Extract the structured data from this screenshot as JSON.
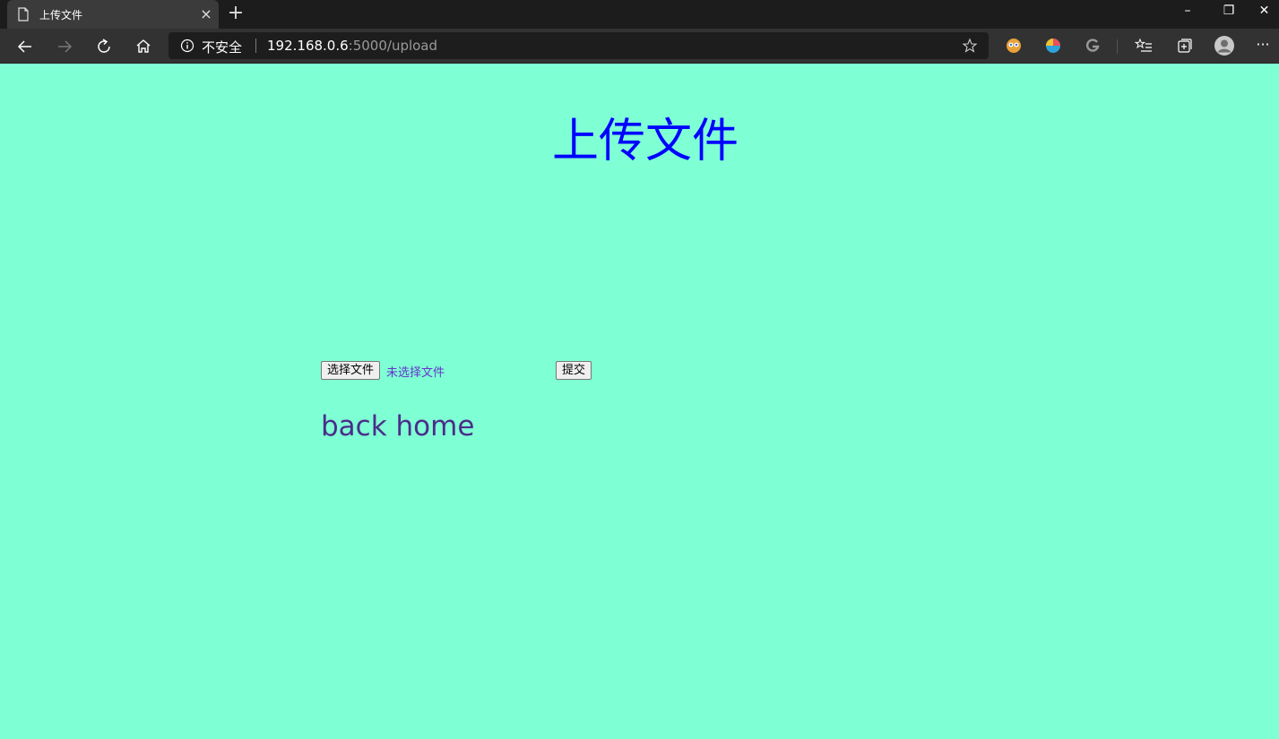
{
  "browser": {
    "tab_title": "上传文件",
    "tab_close": "×",
    "new_tab": "+",
    "window_minimize": "–",
    "window_restore": "❐",
    "window_close": "✕",
    "security_label": "不安全",
    "url_host": "192.168.0.6",
    "url_rest": ":5000/upload",
    "more_menu": "···",
    "icons": [
      "back-icon",
      "forward-icon",
      "refresh-icon",
      "home-icon",
      "info-icon",
      "star-icon",
      "extension-icon",
      "extension-icon",
      "grammarly-icon",
      "favorites-icon",
      "collections-icon",
      "profile-icon"
    ]
  },
  "page": {
    "title": "上传文件",
    "choose_file_label": "选择文件",
    "no_file_text": "未选择文件",
    "submit_label": "提交",
    "back_link": "back home"
  },
  "colors": {
    "page_background": "#7fffd4",
    "title": "#0000ff",
    "link": "#4b2d8a"
  }
}
